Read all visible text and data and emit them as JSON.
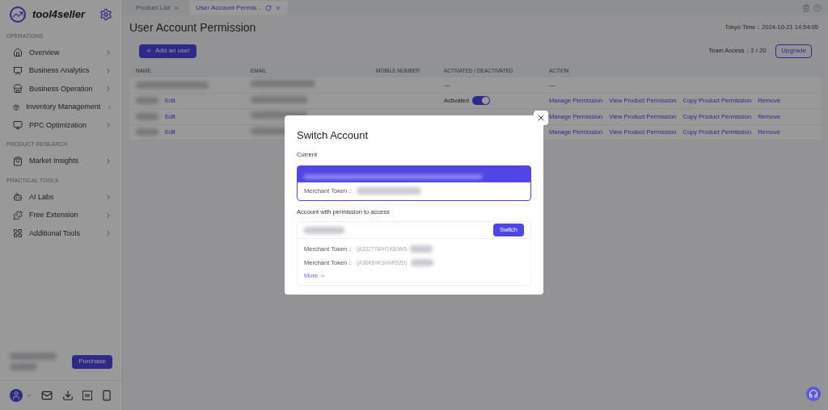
{
  "sidebar": {
    "logo": "tool4seller",
    "sections": [
      {
        "title": "OPERATIONS",
        "items": [
          {
            "label": "Overview"
          },
          {
            "label": "Business Analytics"
          },
          {
            "label": "Business Operation"
          },
          {
            "label": "Inventory Management"
          },
          {
            "label": "PPC Optimization"
          }
        ]
      },
      {
        "title": "PRODUCT RESEARCH",
        "items": [
          {
            "label": "Market Insights"
          }
        ]
      },
      {
        "title": "PRACTICAL TOOLS",
        "items": [
          {
            "label": "AI Labs"
          },
          {
            "label": "Free Extension"
          },
          {
            "label": "Additional Tools"
          }
        ]
      }
    ],
    "purchase_button": "Purchase"
  },
  "tabs": [
    {
      "label": "Product List",
      "selected": false
    },
    {
      "label": "User Account Permis...",
      "selected": true
    }
  ],
  "page": {
    "title": "User Account Permission",
    "time_label": "Tokyo Time：",
    "time": "2024-10-21 14:54:05",
    "add_button": "Add an user",
    "team_access": "Team Access：2 / 20",
    "upgrade_button": "Upgrade"
  },
  "table": {
    "columns": [
      "NAME",
      "EMAIL",
      "MOBILE NUMBER",
      "ACTIVATED / DEACTIVATED",
      "ACTION"
    ],
    "rows": [
      {
        "status": "---",
        "action_text": "---"
      },
      {
        "edit": "Edit",
        "status": "Activated",
        "activated": true,
        "actions": [
          "Manage Permission",
          "View Product Permission",
          "Copy Product Permission",
          "Remove"
        ]
      },
      {
        "edit": "Edit",
        "actions": [
          "Manage Permission",
          "View Product Permission",
          "Copy Product Permission",
          "Remove"
        ]
      },
      {
        "edit": "Edit",
        "actions": [
          "Manage Permission",
          "View Product Permission",
          "Copy Product Permission",
          "Remove"
        ]
      }
    ]
  },
  "modal": {
    "title": "Switch Account",
    "current_label": "Current",
    "current_token_label": "Merchant Token：",
    "access_label": "Account with permission to access",
    "switch_button": "Switch",
    "tokens": [
      {
        "label": "Merchant Token：",
        "value": "(A332T7MYGX80WS"
      },
      {
        "label": "Merchant Token：",
        "value": "(A3BK89K3HNR5ZU)"
      }
    ],
    "more": "More"
  }
}
